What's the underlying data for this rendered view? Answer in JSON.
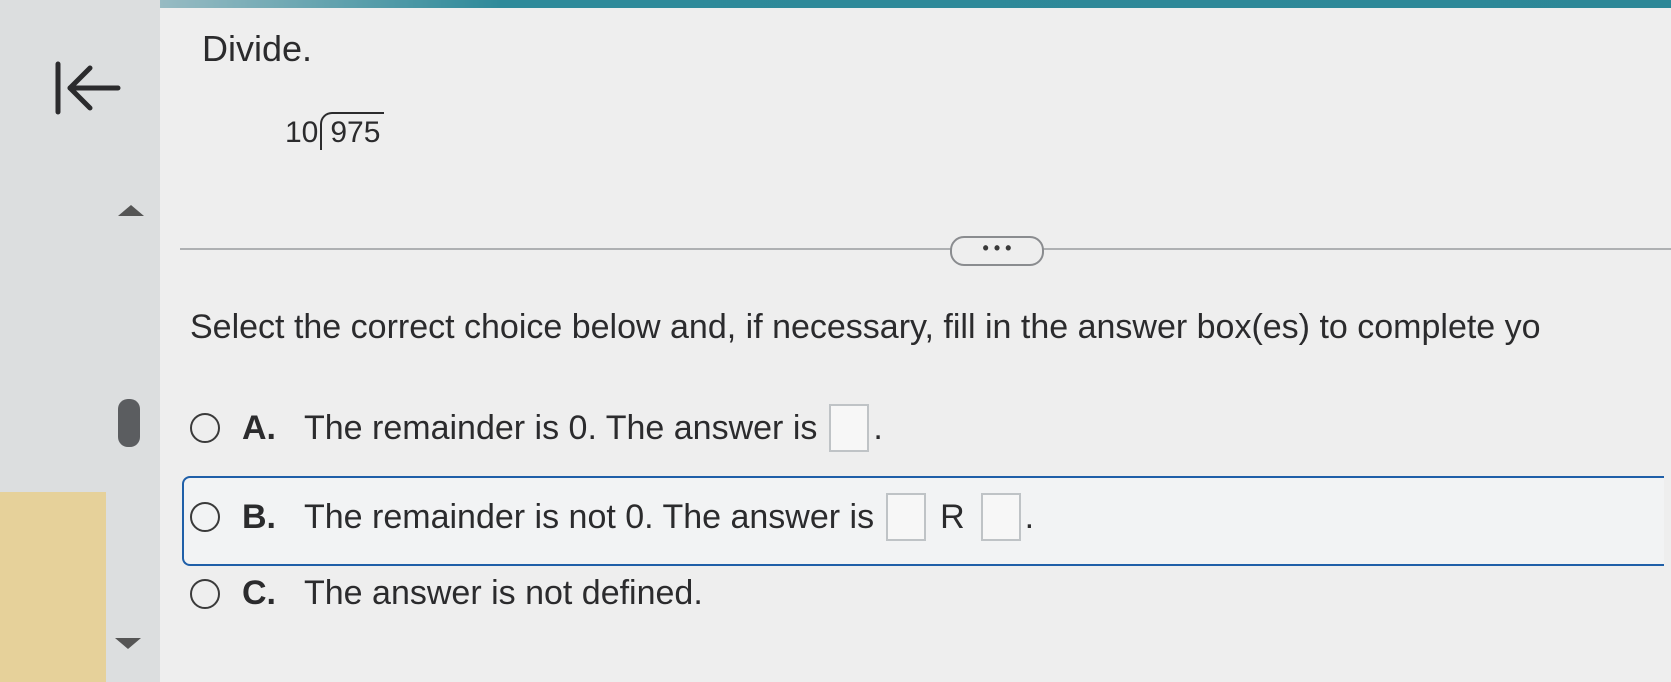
{
  "header": {
    "title": "Divide."
  },
  "problem": {
    "divisor": "10",
    "dividend": "975"
  },
  "more_button": "• • •",
  "instruction": "Select the correct choice below and, if necessary, fill in the answer box(es) to complete yo",
  "choices": [
    {
      "letter": "A.",
      "text": "The remainder is 0. The answer is",
      "suffix": "."
    },
    {
      "letter": "B.",
      "text": "The remainder is not 0. The answer is",
      "middle": "R",
      "suffix": "."
    },
    {
      "letter": "C.",
      "text": "The answer is not defined."
    }
  ],
  "colors": {
    "accent": "#2d8797",
    "selection_border": "#1f5fa8"
  },
  "icons": {
    "back": "back-to-start-icon",
    "scroll_up": "triangle-up-icon",
    "scroll_down": "triangle-down-icon"
  }
}
